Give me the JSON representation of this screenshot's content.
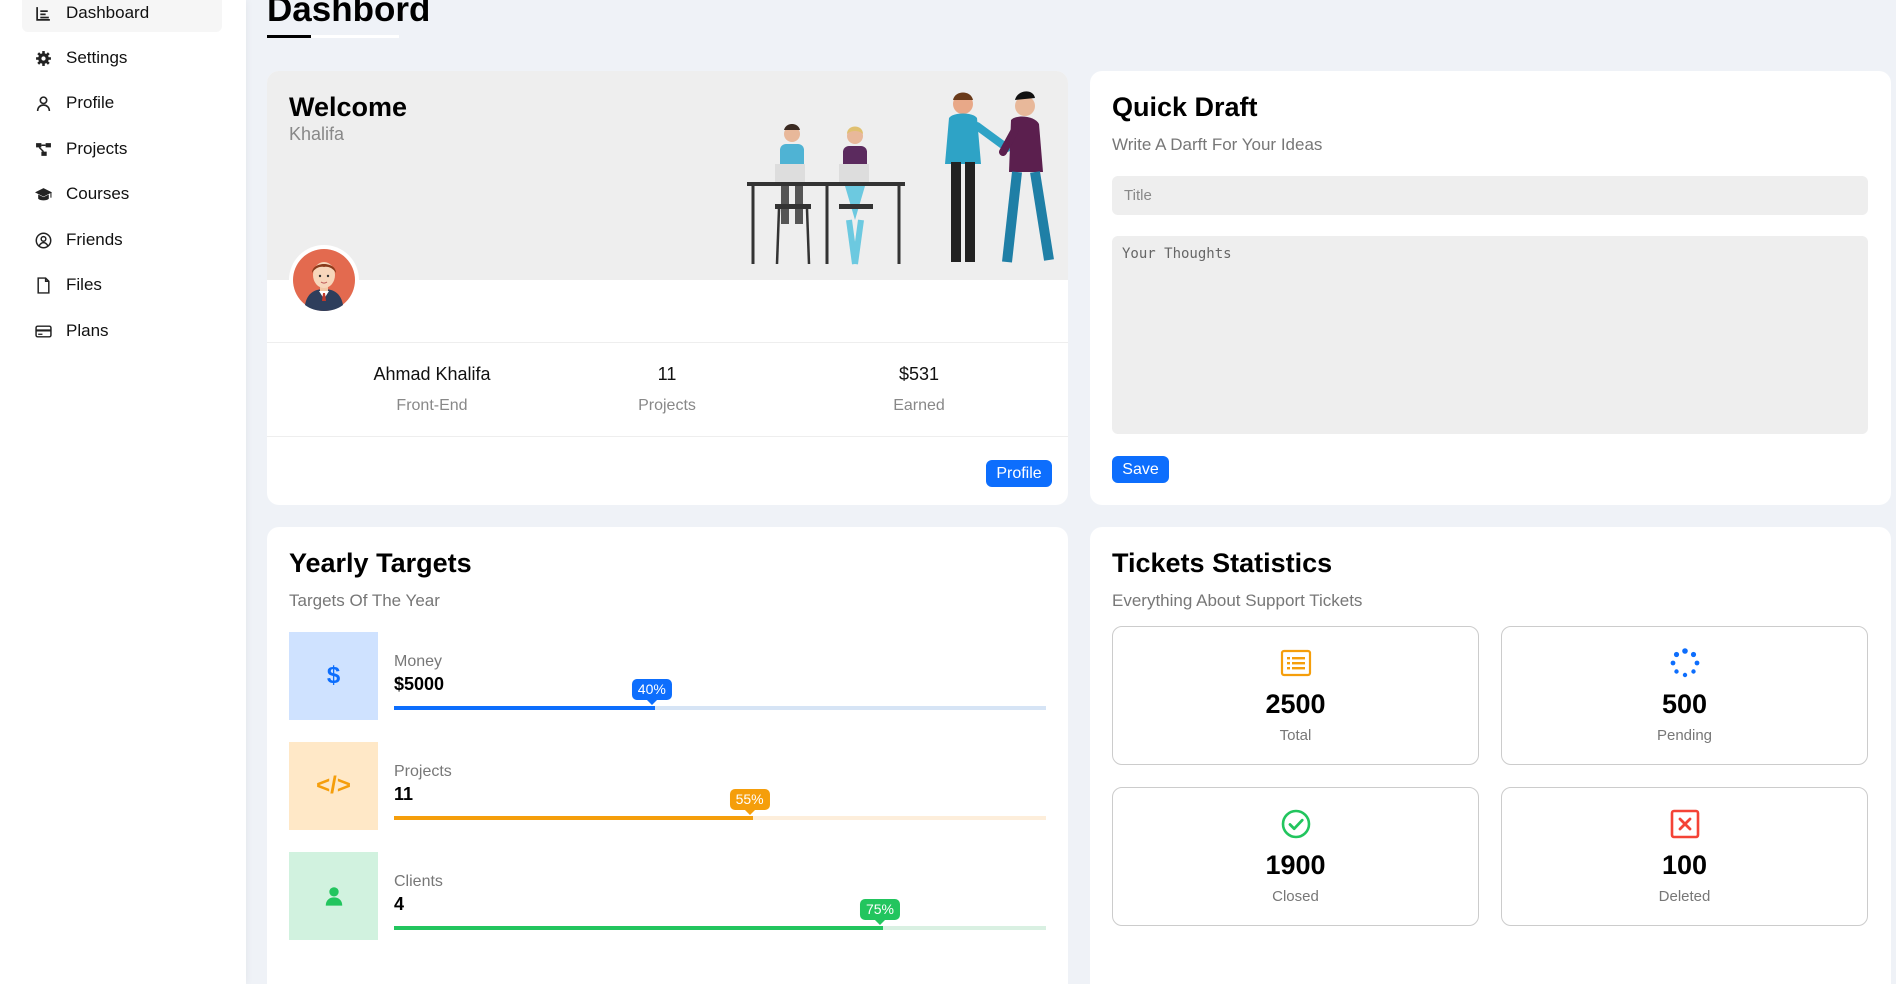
{
  "sidebar": {
    "items": [
      {
        "label": "Dashboard",
        "icon": "chart-icon",
        "active": true
      },
      {
        "label": "Settings",
        "icon": "gear-icon"
      },
      {
        "label": "Profile",
        "icon": "user-icon"
      },
      {
        "label": "Projects",
        "icon": "diagram-icon"
      },
      {
        "label": "Courses",
        "icon": "graduation-cap-icon"
      },
      {
        "label": "Friends",
        "icon": "user-circle-icon"
      },
      {
        "label": "Files",
        "icon": "file-icon"
      },
      {
        "label": "Plans",
        "icon": "credit-card-icon"
      }
    ]
  },
  "page": {
    "title": "Dashbord"
  },
  "welcome": {
    "title": "Welcome",
    "subtitle": "Khalifa",
    "stats": [
      {
        "value": "Ahmad Khalifa",
        "label": "Front-End"
      },
      {
        "value": "11",
        "label": "Projects"
      },
      {
        "value": "$531",
        "label": "Earned"
      }
    ],
    "button": "Profile"
  },
  "draft": {
    "title": "Quick Draft",
    "subtitle": "Write A Darft For Your Ideas",
    "title_placeholder": "Title",
    "text_placeholder": "Your Thoughts",
    "button": "Save"
  },
  "targets": {
    "title": "Yearly Targets",
    "subtitle": "Targets Of The Year",
    "items": [
      {
        "label": "Money",
        "value": "$5000",
        "percent": 40,
        "badge": "40%",
        "icon": "dollar-icon",
        "color": "#0d6efd",
        "bg": "#cfe2ff",
        "track": "#d6e4f5"
      },
      {
        "label": "Projects",
        "value": "11",
        "percent": 55,
        "badge": "55%",
        "icon": "code-icon",
        "color": "#f59e0b",
        "bg": "#ffe8c7",
        "track": "#fdeedb"
      },
      {
        "label": "Clients",
        "value": "4",
        "percent": 75,
        "badge": "75%",
        "icon": "user-icon",
        "color": "#22c55e",
        "bg": "#d1f2df",
        "track": "#d9f0e2"
      }
    ]
  },
  "tickets": {
    "title": "Tickets Statistics",
    "subtitle": "Everything About Support Tickets",
    "items": [
      {
        "value": "2500",
        "label": "Total",
        "icon": "list-icon",
        "color": "#f59e0b"
      },
      {
        "value": "500",
        "label": "Pending",
        "icon": "spinner-icon",
        "color": "#0d6efd"
      },
      {
        "value": "1900",
        "label": "Closed",
        "icon": "check-circle-icon",
        "color": "#22c55e"
      },
      {
        "value": "100",
        "label": "Deleted",
        "icon": "x-box-icon",
        "color": "#f44336"
      }
    ]
  }
}
